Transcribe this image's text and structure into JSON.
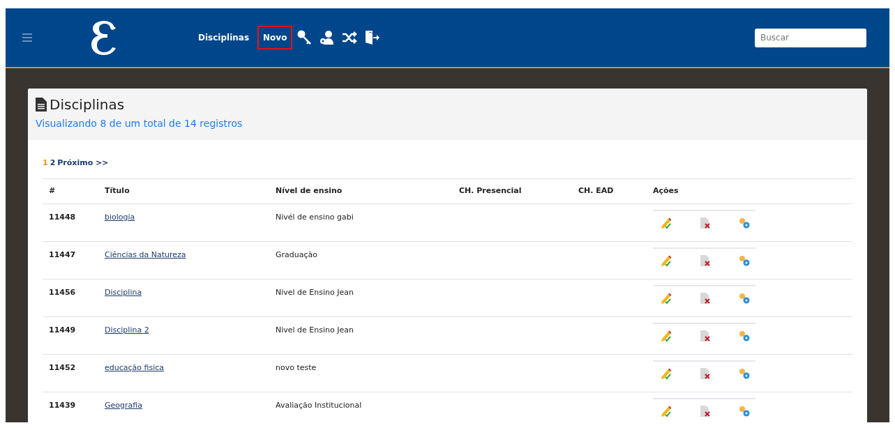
{
  "navbar": {
    "links": [
      {
        "label": "Disciplinas",
        "highlighted": false
      },
      {
        "label": "Novo",
        "highlighted": true
      }
    ],
    "icons": [
      {
        "kind": "key"
      },
      {
        "kind": "user-gear"
      },
      {
        "kind": "shuffle"
      },
      {
        "kind": "logout"
      }
    ],
    "search": {
      "placeholder": "Buscar"
    }
  },
  "card": {
    "title": "Disciplinas",
    "subtitle": "Visualizando 8 de um total de 14 registros"
  },
  "pagination": [
    {
      "label": "1",
      "selected": true
    },
    {
      "label": "2",
      "selected": false
    },
    {
      "label": "Próximo >>",
      "selected": false
    }
  ],
  "table": {
    "columns": [
      "#",
      "Título",
      "Nível de ensino",
      "CH. Presencial",
      "CH. EAD",
      "Ações"
    ],
    "rows": [
      {
        "id": "11448",
        "title": "biologia",
        "level": "Nivél de ensino gabi"
      },
      {
        "id": "11447",
        "title": "Ciências da Natureza",
        "level": "Graduação"
      },
      {
        "id": "11456",
        "title": "Disciplina",
        "level": "Nivel de Ensino Jean"
      },
      {
        "id": "11449",
        "title": "Disciplina 2",
        "level": "Nivel de Ensino Jean"
      },
      {
        "id": "11452",
        "title": "educação fisica",
        "level": "novo teste"
      },
      {
        "id": "11439",
        "title": "Geografia",
        "level": "Avaliação Institucional"
      }
    ]
  }
}
